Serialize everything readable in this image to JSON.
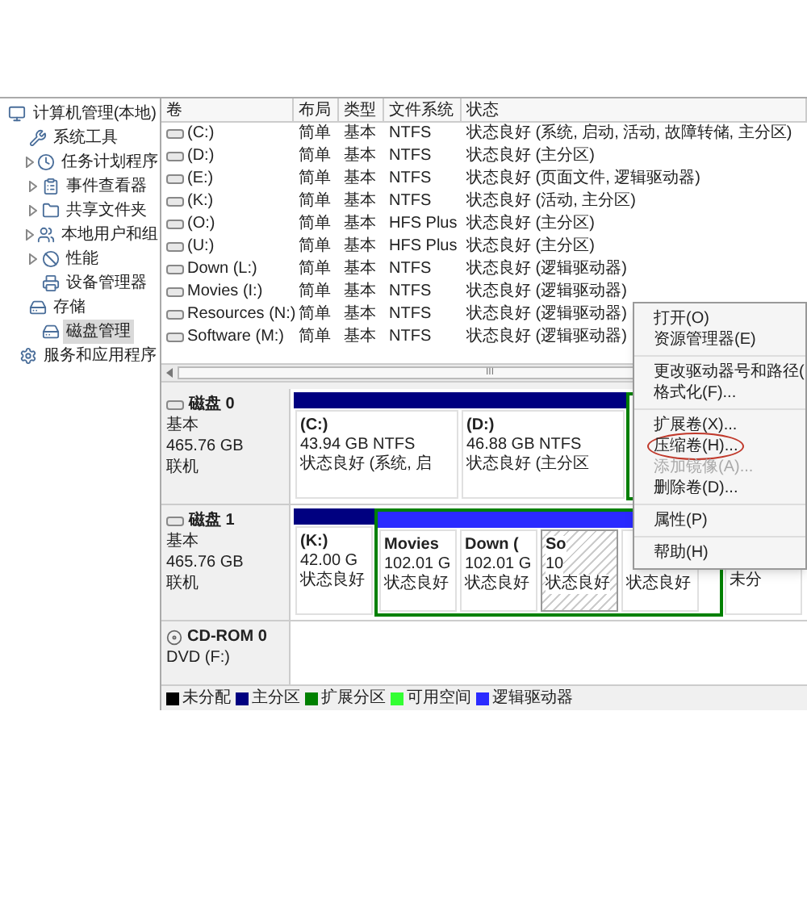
{
  "tree": [
    {
      "label": "计算机管理(本地)",
      "expandable": false,
      "selected": false,
      "children": [
        {
          "label": "系统工具",
          "expandable": false,
          "selected": false,
          "children": [
            {
              "label": "任务计划程序",
              "expandable": true,
              "selected": false
            },
            {
              "label": "事件查看器",
              "expandable": true,
              "selected": false
            },
            {
              "label": "共享文件夹",
              "expandable": true,
              "selected": false
            },
            {
              "label": "本地用户和组",
              "expandable": true,
              "selected": false
            },
            {
              "label": "性能",
              "expandable": true,
              "selected": false
            },
            {
              "label": "设备管理器",
              "expandable": false,
              "selected": false
            }
          ]
        },
        {
          "label": "存储",
          "expandable": false,
          "selected": false,
          "children": [
            {
              "label": "磁盘管理",
              "expandable": false,
              "selected": true
            }
          ]
        },
        {
          "label": "服务和应用程序",
          "expandable": false,
          "selected": false
        }
      ]
    }
  ],
  "table": {
    "columns": [
      "卷",
      "布局",
      "类型",
      "文件系统",
      "状态"
    ],
    "rows": [
      [
        "(C:)",
        "简单",
        "基本",
        "NTFS",
        "状态良好 (系统, 启动, 活动, 故障转储, 主分区)"
      ],
      [
        "(D:)",
        "简单",
        "基本",
        "NTFS",
        "状态良好 (主分区)"
      ],
      [
        "(E:)",
        "简单",
        "基本",
        "NTFS",
        "状态良好 (页面文件, 逻辑驱动器)"
      ],
      [
        "(K:)",
        "简单",
        "基本",
        "NTFS",
        "状态良好 (活动, 主分区)"
      ],
      [
        "(O:)",
        "简单",
        "基本",
        "HFS Plus",
        "状态良好 (主分区)"
      ],
      [
        "(U:)",
        "简单",
        "基本",
        "HFS Plus",
        "状态良好 (主分区)"
      ],
      [
        "Down (L:)",
        "简单",
        "基本",
        "NTFS",
        "状态良好 (逻辑驱动器)"
      ],
      [
        "Movies (I:)",
        "简单",
        "基本",
        "NTFS",
        "状态良好 (逻辑驱动器)"
      ],
      [
        "Resources (N:)",
        "简单",
        "基本",
        "NTFS",
        "状态良好 (逻辑驱动器)"
      ],
      [
        "Software (M:)",
        "简单",
        "基本",
        "NTFS",
        "状态良好 (逻辑驱动器)"
      ]
    ],
    "scroll_grip": "III"
  },
  "disks": [
    {
      "kind": "disk",
      "name": "磁盘 0",
      "type": "基本",
      "size": "465.76 GB",
      "status": "联机",
      "partitions": [
        {
          "kind": "primary",
          "name": "(C:)",
          "size": "43.94 GB NTFS",
          "status": "状态良好 (系统, 启"
        },
        {
          "kind": "primary",
          "name": "(D:)",
          "size": "46.88 GB NTFS",
          "status": "状态良好 (主分区"
        },
        {
          "kind": "extended"
        }
      ]
    },
    {
      "kind": "disk",
      "name": "磁盘 1",
      "type": "基本",
      "size": "465.76 GB",
      "status": "联机",
      "partitions": [
        {
          "kind": "primary",
          "name": "(K:)",
          "size": "42.00 G",
          "status": "状态良好"
        },
        {
          "kind": "extended",
          "children": [
            {
              "kind": "logical",
              "name": "Movies",
              "size": "102.01 G",
              "status": "状态良好",
              "selected": false
            },
            {
              "kind": "logical",
              "name": "Down (",
              "size": "102.01 G",
              "status": "状态良好",
              "selected": false
            },
            {
              "kind": "logical",
              "name": "So",
              "size": "10",
              "status": "状态良好",
              "selected": true
            },
            {
              "kind": "logical",
              "status": "状态良好",
              "selected": false
            }
          ]
        },
        {
          "kind": "unallocated",
          "status": "未分"
        }
      ]
    },
    {
      "kind": "cdrom",
      "name": "CD-ROM 0",
      "type": "DVD (F:)"
    }
  ],
  "legend": [
    {
      "label": "未分配",
      "color": "#000000"
    },
    {
      "label": "主分区",
      "color": "#000080"
    },
    {
      "label": "扩展分区",
      "color": "#008000"
    },
    {
      "label": "可用空间",
      "color": "#33ff33"
    },
    {
      "label": "逻辑驱动器",
      "color": "#2a2aff"
    }
  ],
  "context_menu": [
    [
      {
        "label": "打开(O)",
        "disabled": false,
        "circled": false
      },
      {
        "label": "资源管理器(E)",
        "disabled": false,
        "circled": false
      }
    ],
    [
      {
        "label": "更改驱动器号和路径(",
        "disabled": false,
        "circled": false
      },
      {
        "label": "格式化(F)...",
        "disabled": false,
        "circled": false
      }
    ],
    [
      {
        "label": "扩展卷(X)...",
        "disabled": false,
        "circled": false
      },
      {
        "label": "压缩卷(H)...",
        "disabled": false,
        "circled": true
      },
      {
        "label": "添加镜像(A)...",
        "disabled": true,
        "circled": false
      },
      {
        "label": "删除卷(D)...",
        "disabled": false,
        "circled": false
      }
    ],
    [
      {
        "label": "属性(P)",
        "disabled": false,
        "circled": false
      }
    ],
    [
      {
        "label": "帮助(H)",
        "disabled": false,
        "circled": false
      }
    ]
  ]
}
